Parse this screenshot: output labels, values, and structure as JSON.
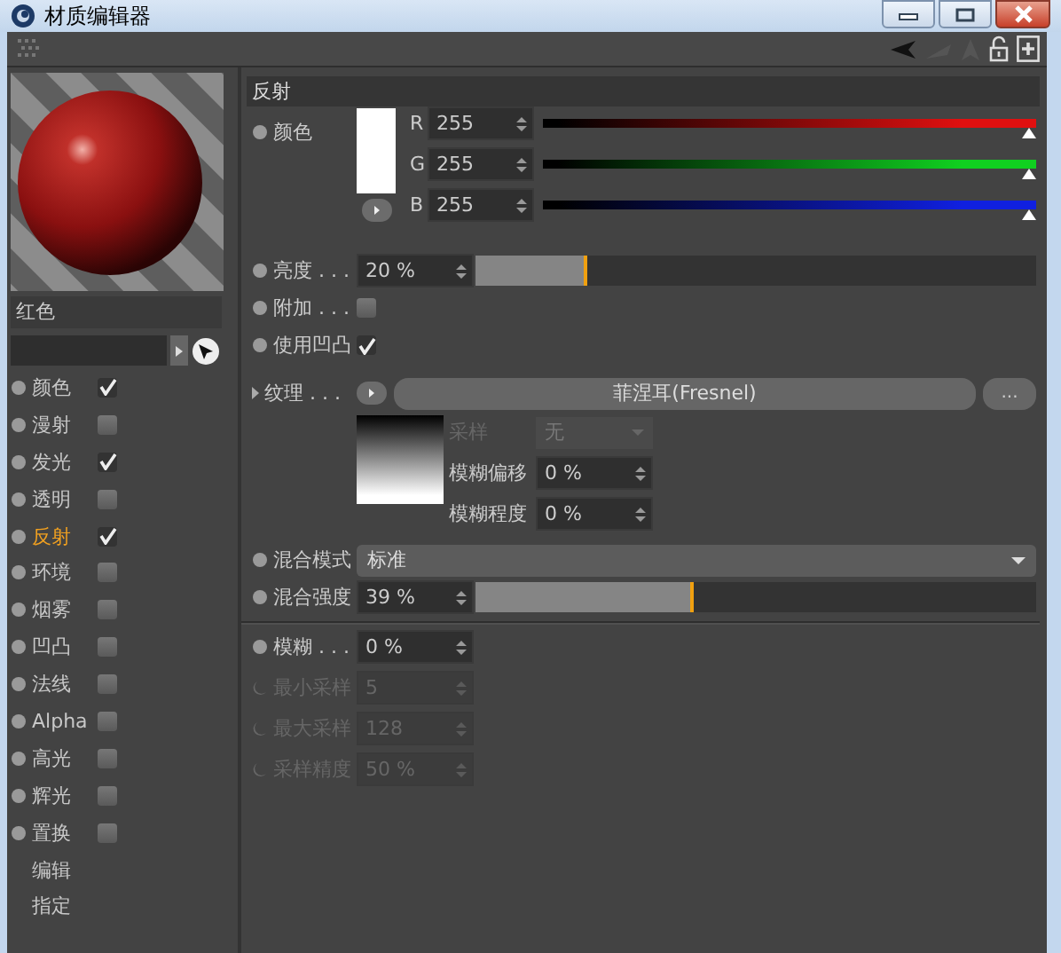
{
  "window": {
    "title": "材质编辑器"
  },
  "material": {
    "name": "红色"
  },
  "channels": [
    {
      "label": "颜色",
      "kind": "check",
      "checked": true,
      "selected": false
    },
    {
      "label": "漫射",
      "kind": "check",
      "checked": false,
      "selected": false
    },
    {
      "label": "发光",
      "kind": "check",
      "checked": true,
      "selected": false
    },
    {
      "label": "透明",
      "kind": "check",
      "checked": false,
      "selected": false
    },
    {
      "label": "反射",
      "kind": "check",
      "checked": true,
      "selected": true
    },
    {
      "label": "环境",
      "kind": "check",
      "checked": false,
      "selected": false
    },
    {
      "label": "烟雾",
      "kind": "check",
      "checked": false,
      "selected": false
    },
    {
      "label": "凹凸",
      "kind": "check",
      "checked": false,
      "selected": false
    },
    {
      "label": "法线",
      "kind": "check",
      "checked": false,
      "selected": false
    },
    {
      "label": "Alpha",
      "kind": "check",
      "checked": false,
      "selected": false
    },
    {
      "label": "高光",
      "kind": "check",
      "checked": false,
      "selected": false
    },
    {
      "label": "辉光",
      "kind": "check",
      "checked": false,
      "selected": false
    },
    {
      "label": "置换",
      "kind": "check",
      "checked": false,
      "selected": false
    },
    {
      "label": "编辑",
      "kind": "plain",
      "selected": false
    },
    {
      "label": "指定",
      "kind": "plain",
      "selected": false
    }
  ],
  "section": {
    "title": "反射",
    "rows": [
      {
        "kind": "color",
        "label": "颜色",
        "disabled": false,
        "channels": [
          {
            "name": "R",
            "value": "255",
            "level": 1,
            "color": "#e01010"
          },
          {
            "name": "G",
            "value": "255",
            "level": 1,
            "color": "#10d020"
          },
          {
            "name": "B",
            "value": "255",
            "level": 1,
            "color": "#1020e0"
          }
        ]
      },
      {
        "kind": "slider",
        "label": "亮度 . . .",
        "value": "20 %",
        "level": 0.2,
        "disabled": false
      },
      {
        "kind": "check",
        "label": "附加 . . .",
        "checked": false,
        "disabled": false
      },
      {
        "kind": "check",
        "label": "使用凹凸",
        "checked": true,
        "disabled": false
      },
      {
        "kind": "texture",
        "label": "纹理 . . .",
        "shader": "菲涅耳(Fresnel)",
        "more": "...",
        "disabled": false,
        "options": [
          {
            "kind": "select",
            "label": "采样",
            "value": "无",
            "disabled": true
          },
          {
            "kind": "number",
            "label": "模糊偏移",
            "value": "0 %",
            "disabled": false
          },
          {
            "kind": "number",
            "label": "模糊程度",
            "value": "0 %",
            "disabled": false
          }
        ]
      },
      {
        "kind": "select",
        "label": "混合模式",
        "value": "标准",
        "disabled": false
      },
      {
        "kind": "slider",
        "label": "混合强度",
        "value": "39 %",
        "level": 0.39,
        "disabled": false
      },
      {
        "kind": "separator"
      },
      {
        "kind": "number",
        "label": "模糊 . . .",
        "value": "0 %",
        "disabled": false
      },
      {
        "kind": "number",
        "label": "最小采样",
        "value": "5",
        "disabled": true
      },
      {
        "kind": "number",
        "label": "最大采样",
        "value": "128",
        "disabled": true
      },
      {
        "kind": "number",
        "label": "采样精度",
        "value": "50 %",
        "disabled": true
      }
    ]
  }
}
